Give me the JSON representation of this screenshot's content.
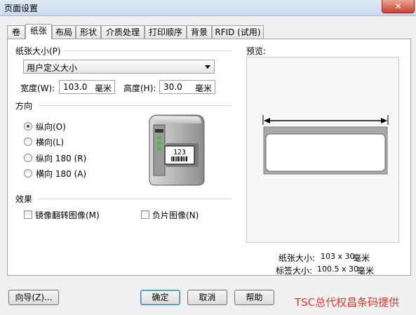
{
  "window": {
    "title": "页面设置",
    "close_glyph": "✕"
  },
  "tabs": [
    "卷",
    "纸张",
    "布局",
    "形状",
    "介质处理",
    "打印顺序",
    "背景",
    "RFID (试用)"
  ],
  "paper_size": {
    "section": "纸张大小(P)",
    "selected": "用户定义大小"
  },
  "width": {
    "label": "宽度(W):",
    "value": "103.0",
    "unit": "毫米"
  },
  "height": {
    "label": "高度(H):",
    "value": "30.0",
    "unit": "毫米"
  },
  "orientation": {
    "section": "方向",
    "options": [
      "纵向(O)",
      "横向(L)",
      "纵向 180 (R)",
      "横向 180 (A)"
    ],
    "selected": "纵向(O)"
  },
  "printer_label_text": "123",
  "effects": {
    "section": "效果",
    "mirror": "镜像翻转图像(M)",
    "negative": "负片图像(N)"
  },
  "preview": {
    "label": "预览:",
    "paper_size_label": "纸张大小:",
    "paper_size_value": "103 x 30",
    "paper_size_unit": "毫米",
    "label_size_label": "标签大小:",
    "label_size_value": "100.5 x 30",
    "label_size_unit": "毫米"
  },
  "buttons": {
    "wizard": "向导(Z)...",
    "ok": "确定",
    "cancel": "取消",
    "help": "帮助"
  },
  "watermark": "TSC总代权昌条码提供"
}
